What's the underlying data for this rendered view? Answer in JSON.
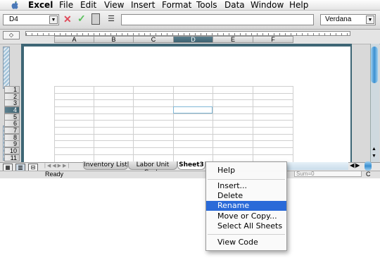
{
  "menubar": {
    "app": "Excel",
    "items": [
      "File",
      "Edit",
      "View",
      "Insert",
      "Format",
      "Tools",
      "Data",
      "Window",
      "Help"
    ]
  },
  "formula_bar": {
    "name_box": "D4",
    "formula": "",
    "font": "Verdana"
  },
  "columns": [
    "A",
    "B",
    "C",
    "D",
    "E",
    "F"
  ],
  "selected_column": "D",
  "rows": [
    "1",
    "2",
    "3",
    "4",
    "5",
    "6",
    "7",
    "8",
    "9",
    "10",
    "11"
  ],
  "selected_row": "4",
  "tabs": [
    "Inventory List",
    "Labor Unit Costs",
    "Sheet3"
  ],
  "active_tab": "Sheet3",
  "status": {
    "text": "Ready",
    "sum": "Sum=0",
    "mode": "C"
  },
  "context_menu": {
    "items": [
      "Help",
      "Insert...",
      "Delete",
      "Rename",
      "Move or Copy...",
      "Select All Sheets",
      "View Code"
    ],
    "highlighted": "Rename"
  },
  "colors": {
    "selected_header": "#3e6270",
    "menu_highlight": "#2a6ad8",
    "page_frame": "#3e6675"
  }
}
